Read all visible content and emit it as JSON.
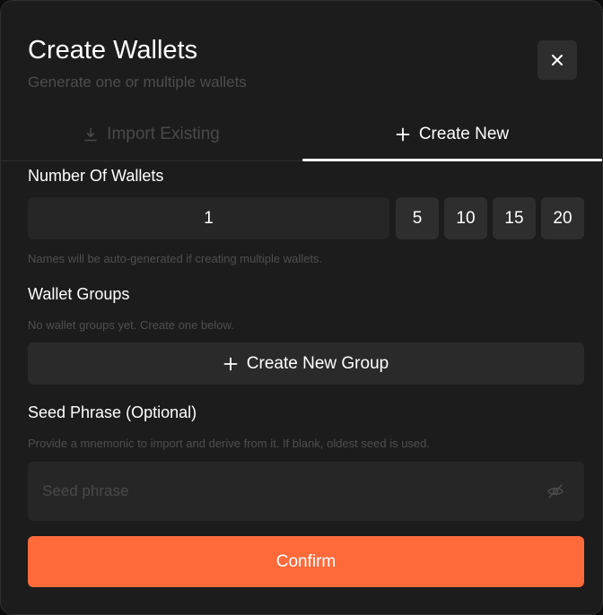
{
  "dialog": {
    "title": "Create Wallets",
    "subtitle": "Generate one or multiple wallets",
    "close_icon": "close-icon"
  },
  "tabs": [
    {
      "label": "Import Existing",
      "icon": "download-icon",
      "active": false
    },
    {
      "label": "Create New",
      "icon": "plus-icon",
      "active": true
    }
  ],
  "wallet_count": {
    "label": "Number Of Wallets",
    "value": "1",
    "presets": [
      "5",
      "10",
      "15",
      "20"
    ],
    "hint": "Names will be auto-generated if creating multiple wallets."
  },
  "wallet_groups": {
    "label": "Wallet Groups",
    "empty_text": "No wallet groups yet. Create one below.",
    "create_button": "Create New Group",
    "create_icon": "plus-icon"
  },
  "seed_phrase": {
    "label": "Seed Phrase (Optional)",
    "hint": "Provide a mnemonic to import and derive from it. If blank, oldest seed is used.",
    "placeholder": "Seed phrase",
    "value": "",
    "toggle_icon": "eye-off-icon"
  },
  "confirm_label": "Confirm",
  "colors": {
    "accent": "#ff6a3b",
    "background": "#1c1c1c",
    "field": "#262626",
    "muted_text": "#4f4f4f"
  }
}
